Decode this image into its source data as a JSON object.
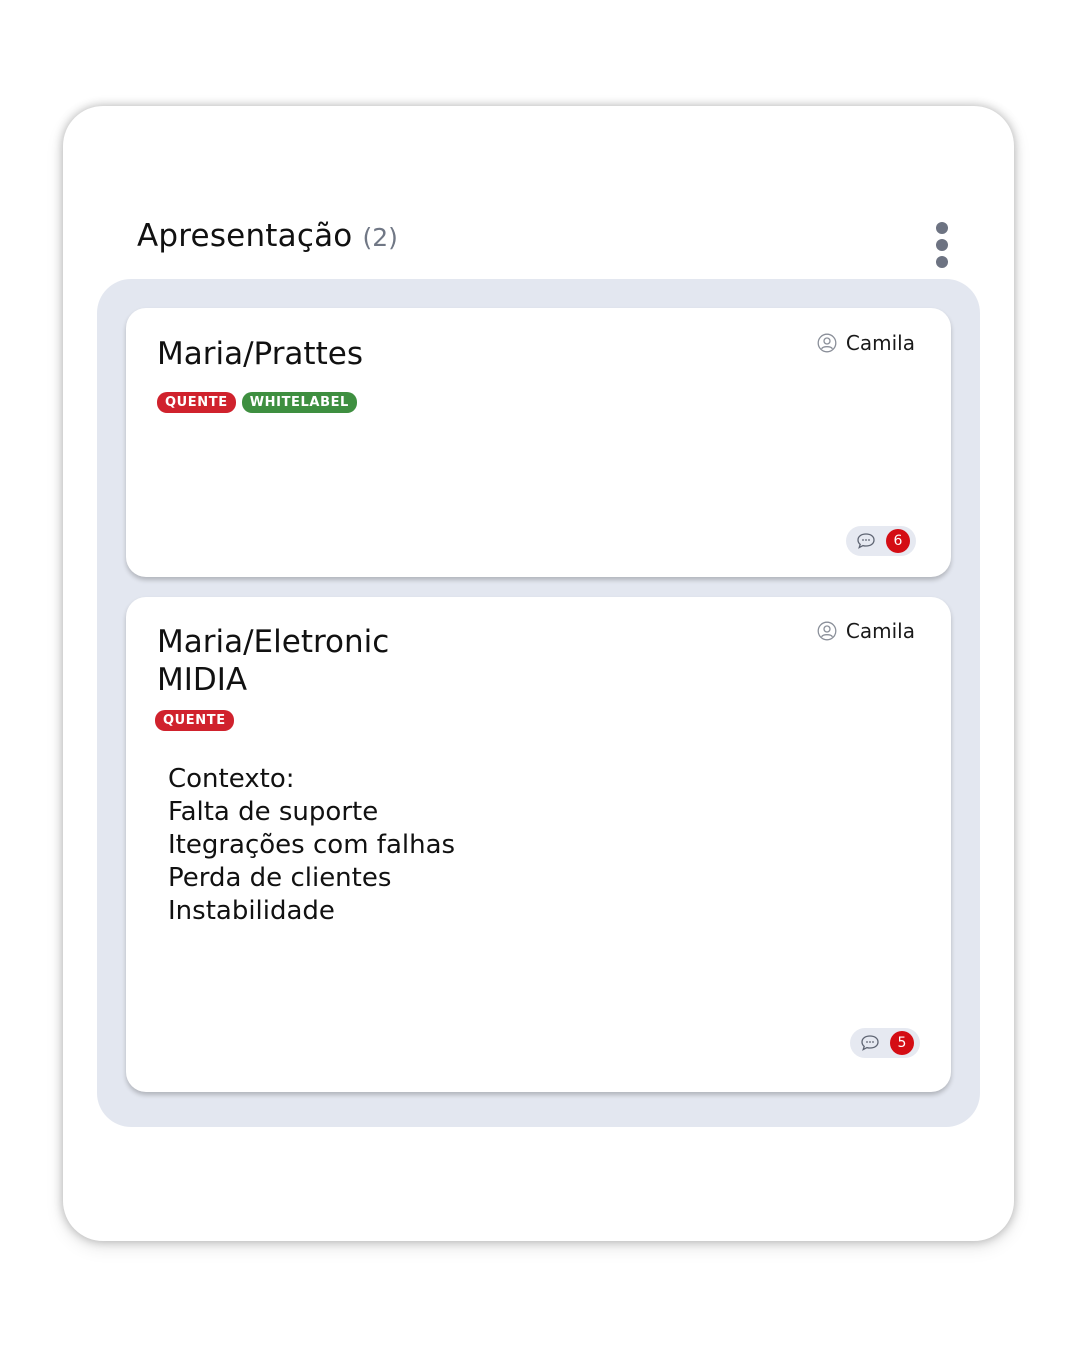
{
  "column": {
    "title": "Apresentação",
    "count": "(2)"
  },
  "cards": [
    {
      "title": "Maria/Prattes",
      "assignee": "Camila",
      "tags": [
        "QUENTE",
        "WHITELABEL"
      ],
      "tag_colors": [
        "#d0222d",
        "#3e8f40"
      ],
      "description": [],
      "comment_count": "6"
    },
    {
      "title_lines": [
        "Maria/Eletronic",
        "MIDIA"
      ],
      "assignee": "Camila",
      "tags": [
        "QUENTE"
      ],
      "tag_colors": [
        "#d0222d"
      ],
      "description": [
        "Contexto:",
        "Falta de suporte",
        "Itegrações com falhas",
        "Perda de clientes",
        "Instabilidade"
      ],
      "comment_count": "5"
    }
  ],
  "icons": {
    "menu": "more-vertical-icon",
    "assignee": "user-circle-icon",
    "comments": "chat-bubble-icon"
  },
  "colors": {
    "lane_background": "#e3e7f0",
    "badge": "#d40d14",
    "tag_quente": "#d0222d",
    "tag_whitelabel": "#3e8f40"
  }
}
